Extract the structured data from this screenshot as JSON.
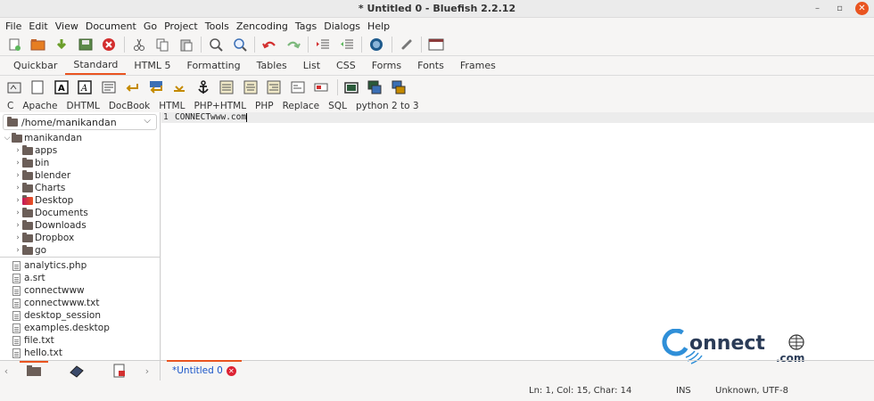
{
  "window": {
    "title": "* Untitled 0 - Bluefish 2.2.12"
  },
  "menu": [
    "File",
    "Edit",
    "View",
    "Document",
    "Go",
    "Project",
    "Tools",
    "Zencoding",
    "Tags",
    "Dialogs",
    "Help"
  ],
  "toolbar_icons": [
    "new-file",
    "open-folder",
    "download",
    "save",
    "close",
    "cut",
    "copy",
    "paste",
    "find",
    "find-replace",
    "undo",
    "redo",
    "indent",
    "unindent",
    "preview-browser",
    "link",
    "fullscreen"
  ],
  "toolbar_tabs": [
    "Quickbar",
    "Standard",
    "HTML 5",
    "Formatting",
    "Tables",
    "List",
    "CSS",
    "Forms",
    "Fonts",
    "Frames"
  ],
  "toolbar_tabs_active": "Standard",
  "snippet_tabs": [
    "C",
    "Apache",
    "DHTML",
    "DocBook",
    "HTML",
    "PHP+HTML",
    "PHP",
    "Replace",
    "SQL",
    "python 2 to 3"
  ],
  "sidebar": {
    "path": "/home/manikandan",
    "root": "manikandan",
    "folders": [
      "apps",
      "bin",
      "blender",
      "Charts",
      "Desktop",
      "Documents",
      "Downloads",
      "Dropbox",
      "go"
    ],
    "files": [
      "analytics.php",
      "a.srt",
      "connectwww",
      "connectwww.txt",
      "desktop_session",
      "examples.desktop",
      "file.txt",
      "hello.txt"
    ]
  },
  "editor": {
    "line_number": "1",
    "content": "CONNECTwww.com"
  },
  "watermark": {
    "brand": "onnect",
    "suffix": ".com"
  },
  "document_tab": {
    "label": "*Untitled 0"
  },
  "statusbar": {
    "position": "Ln: 1, Col: 15, Char: 14",
    "mode": "INS",
    "encoding": "Unknown, UTF-8"
  }
}
